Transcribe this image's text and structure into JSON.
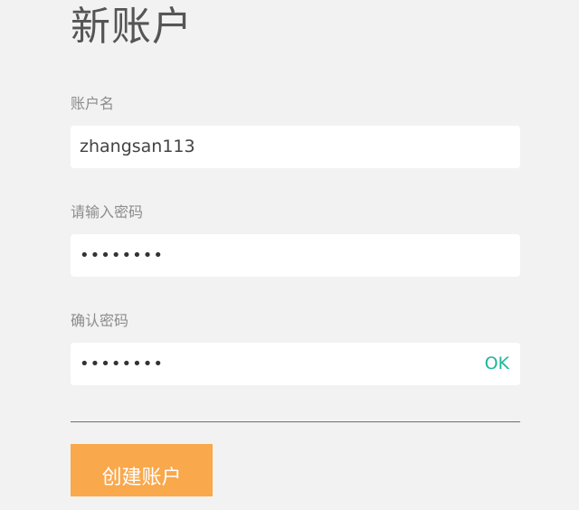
{
  "page": {
    "title": "新账户"
  },
  "form": {
    "account_name": {
      "label": "账户名",
      "value": "zhangsan113"
    },
    "password": {
      "label": "请输入密码",
      "value": "••••••••"
    },
    "confirm_password": {
      "label": "确认密码",
      "value": "••••••••",
      "status": "OK"
    },
    "submit_label": "创建账户"
  },
  "colors": {
    "background": "#f2f2f2",
    "accent_button": "#f9a84c",
    "ok_status": "#20b59a"
  }
}
